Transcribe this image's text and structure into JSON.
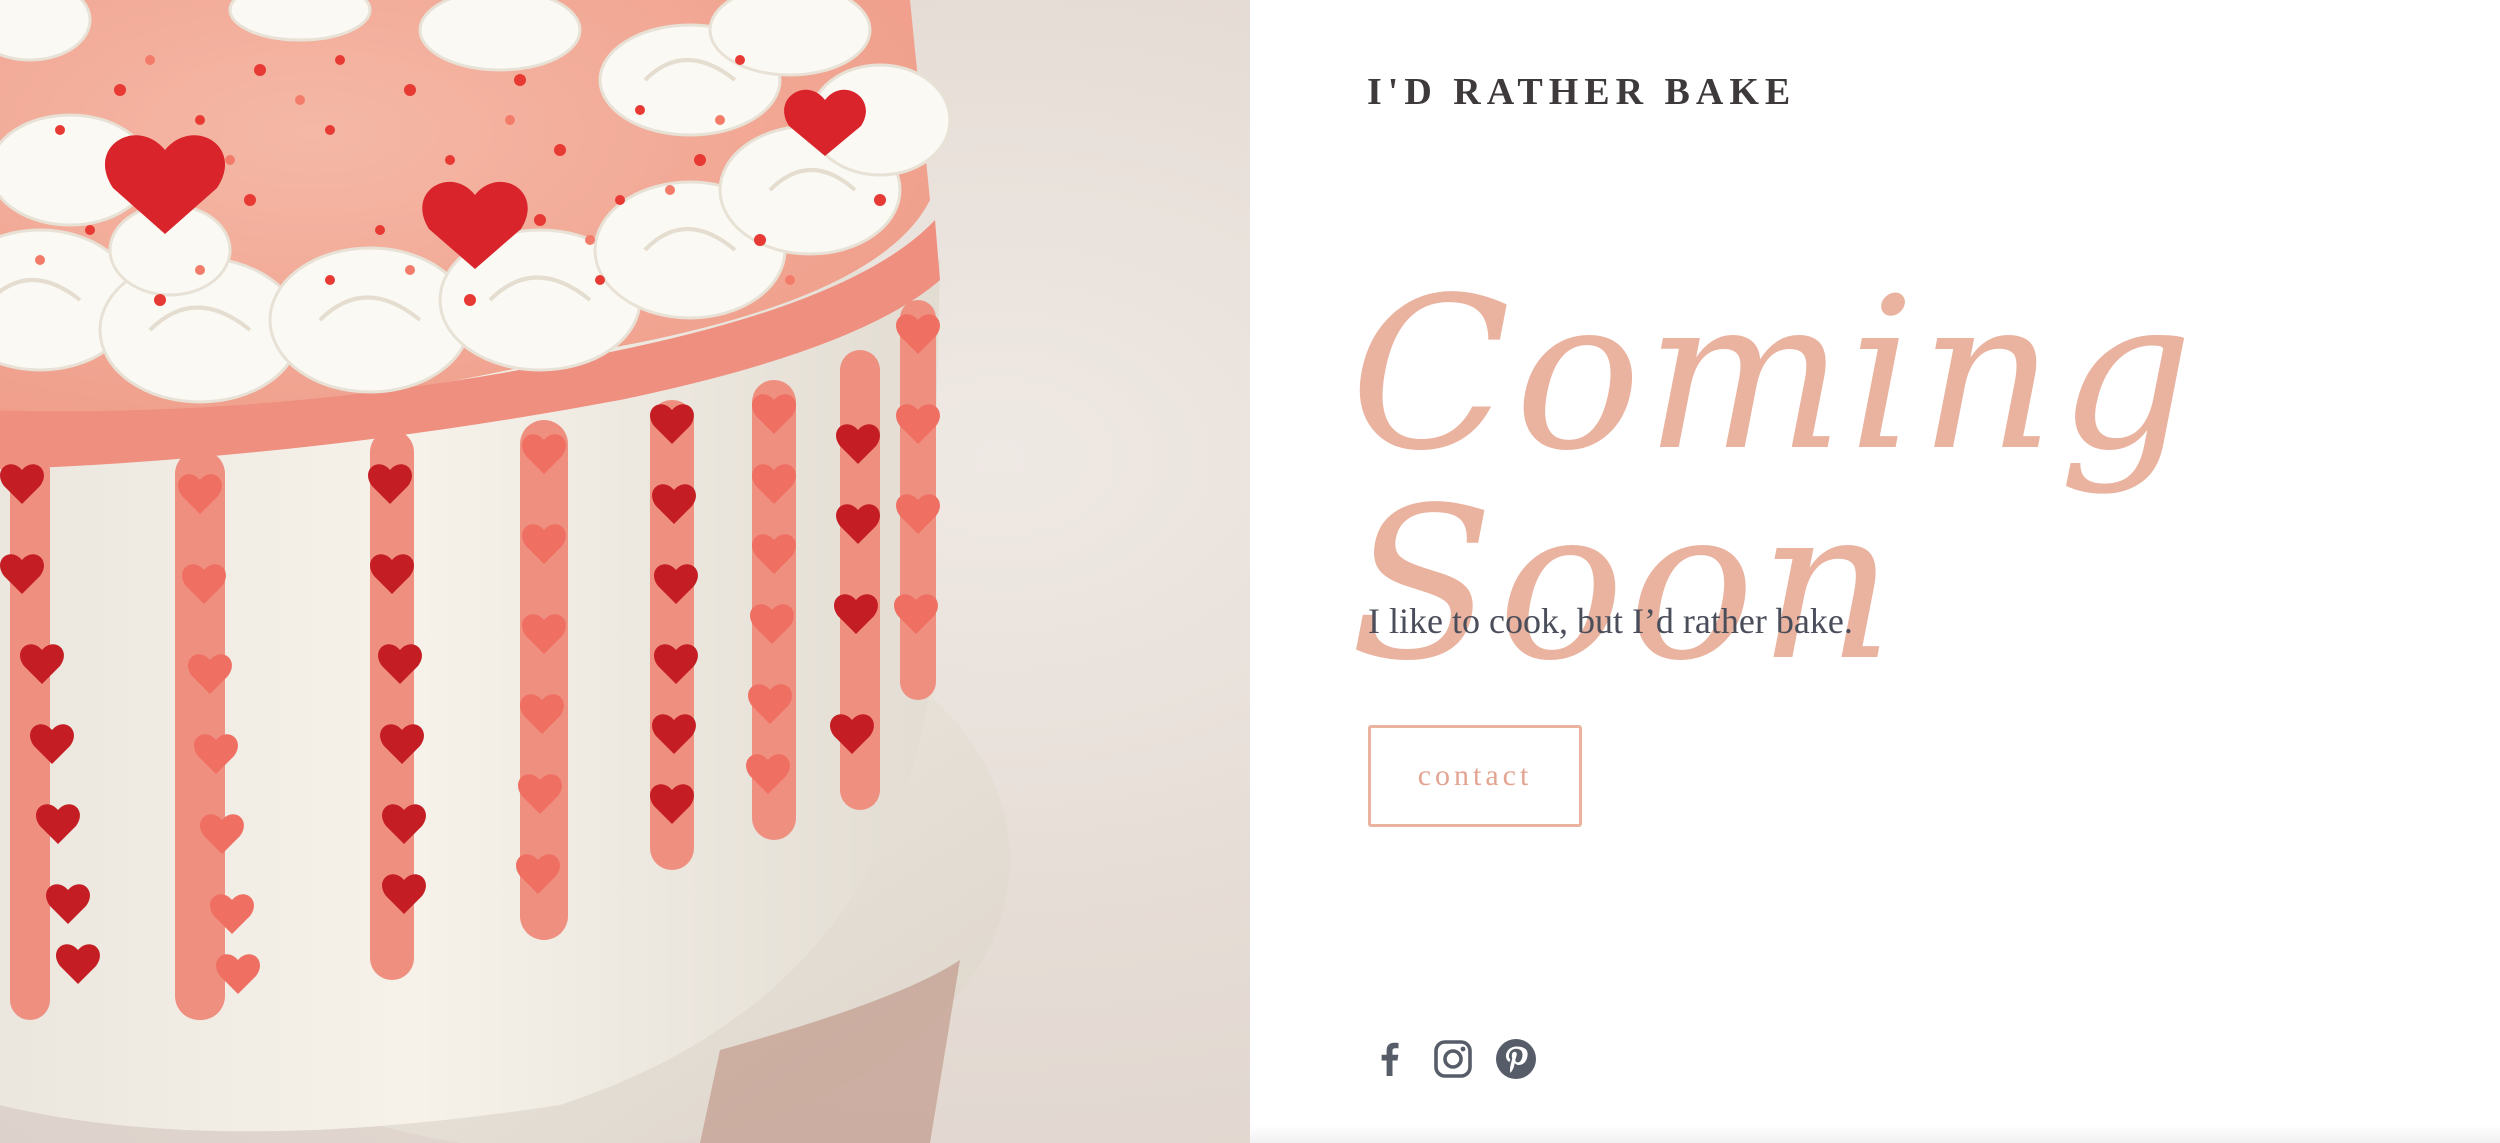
{
  "hero": {
    "image_alt": "Cake with whipped cream swirls, pink drip and heart sprinkles",
    "colors": {
      "frosting": "#f4f0ea",
      "drip": "#ee8f80",
      "heart_red": "#c41e24",
      "heart_pink": "#ef6f63",
      "backdrop": "#e6ddd6"
    }
  },
  "site": {
    "title": "I'D RATHER BAKE"
  },
  "main": {
    "headline": "Coming Soon",
    "tagline": "I like to cook, but I’d rather bake.",
    "contact_label": "contact"
  },
  "social": {
    "icons": [
      "facebook-icon",
      "instagram-icon",
      "pinterest-icon"
    ]
  },
  "colors": {
    "accent": "#eab3a0",
    "text_dark": "#3e3a3b",
    "text_body": "#4a4e5a",
    "icon": "#565c68"
  }
}
